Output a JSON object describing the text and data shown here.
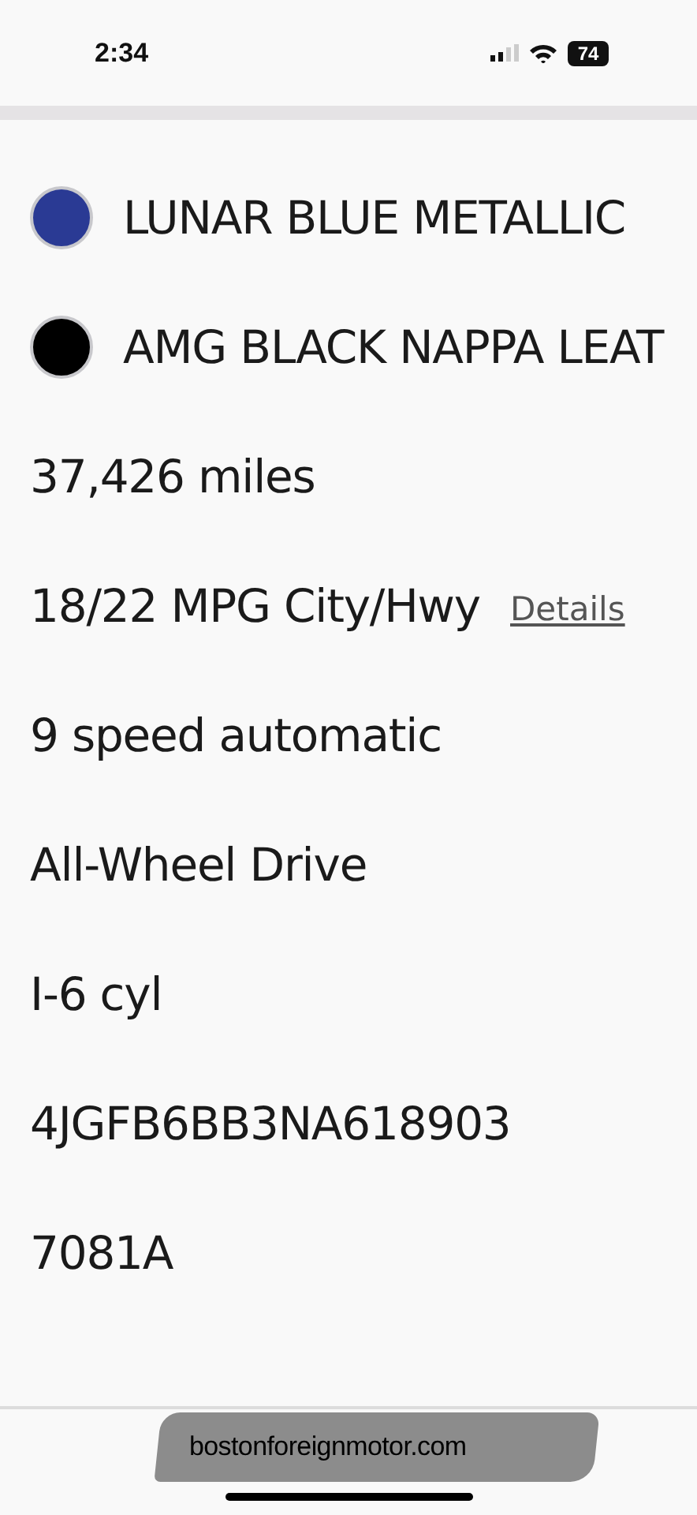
{
  "status_bar": {
    "time": "2:34",
    "battery": "74"
  },
  "specs": [
    {
      "kind": "swatch",
      "label": "LUNAR BLUE METALLIC",
      "color": "#2a3a94"
    },
    {
      "kind": "swatch",
      "label": "AMG BLACK NAPPA LEAT",
      "color": "#000000"
    },
    {
      "kind": "text",
      "label": "37,426 miles"
    },
    {
      "kind": "link",
      "label": "18/22 MPG City/Hwy",
      "link": "Details"
    },
    {
      "kind": "text",
      "label": "9 speed automatic"
    },
    {
      "kind": "text",
      "label": "All-Wheel Drive"
    },
    {
      "kind": "text",
      "label": "I-6 cyl"
    },
    {
      "kind": "text",
      "label": "4JGFB6BB3NA618903"
    },
    {
      "kind": "text",
      "label": "7081A"
    }
  ],
  "address_bar": {
    "url": "bostonforeignmotor.com"
  }
}
